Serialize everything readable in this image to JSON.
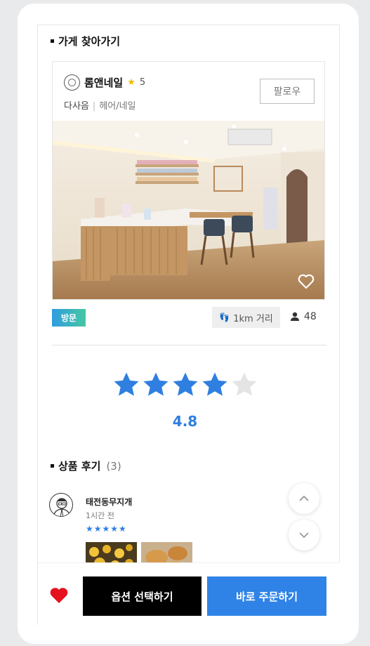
{
  "store_section": {
    "title": "가게 찾아가기",
    "store": {
      "name": "롬앤네일",
      "rating": "5",
      "category": "다사음",
      "subcategory": "헤어/네일",
      "follow_label": "팔로우"
    },
    "visit_tag": "방문",
    "distance": "1km 거리",
    "followers": "48"
  },
  "rating_summary": {
    "value": "4.8",
    "stars_filled": 4,
    "stars_total": 5,
    "star_color": "#2f7fe0"
  },
  "reviews_section": {
    "title": "상품 후기",
    "count": "(3)",
    "review": {
      "author": "태전동무지개",
      "time": "1시간 전",
      "stars": "★★★★★"
    }
  },
  "bottom_bar": {
    "option_label": "옵션 선택하기",
    "buy_label": "바로 주문하기",
    "like_color": "#e5111f",
    "buy_color": "#2f83e6"
  }
}
